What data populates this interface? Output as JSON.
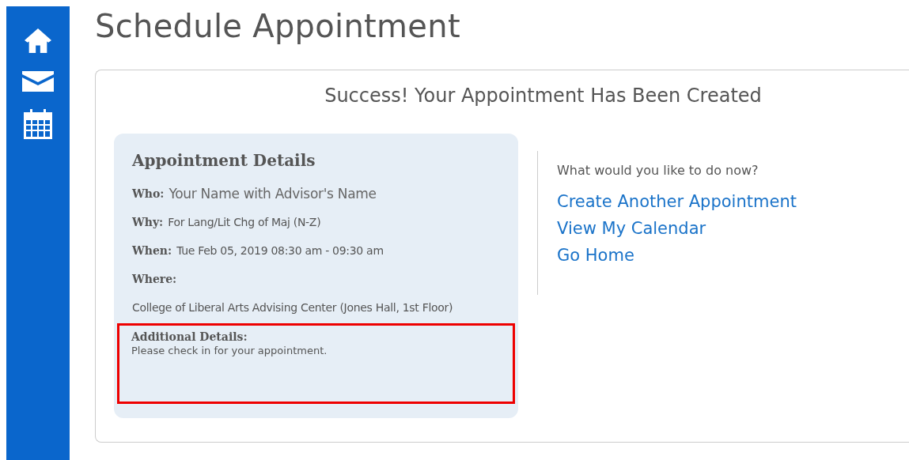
{
  "sidebar": {
    "items": [
      {
        "kind": "home"
      },
      {
        "kind": "mail"
      },
      {
        "kind": "calendar"
      }
    ]
  },
  "page_title": "Schedule Appointment",
  "confirmation": {
    "heading": "Success! Your Appointment Has Been Created",
    "details": {
      "title": "Appointment Details",
      "fields": [
        {
          "label": "Who:",
          "value": "Your Name with Advisor's Name",
          "kind": "inline_large"
        },
        {
          "label": "Why:",
          "value": "For Lang/Lit Chg of Maj (N-Z)",
          "kind": "inline"
        },
        {
          "label": "When:",
          "value": "Tue Feb 05, 2019 08:30 am - 09:30 am",
          "kind": "inline"
        },
        {
          "label": "Where:",
          "value": "College of Liberal Arts Advising Center (Jones Hall, 1st Floor)",
          "kind": "block"
        }
      ],
      "additional": {
        "label": "Additional Details:",
        "value": "Please check in for your appointment.",
        "highlighted": true
      }
    },
    "next_steps": {
      "prompt": "What would you like to do now?",
      "links": [
        "Create Another Appointment",
        "View My Calendar",
        "Go Home"
      ]
    }
  }
}
